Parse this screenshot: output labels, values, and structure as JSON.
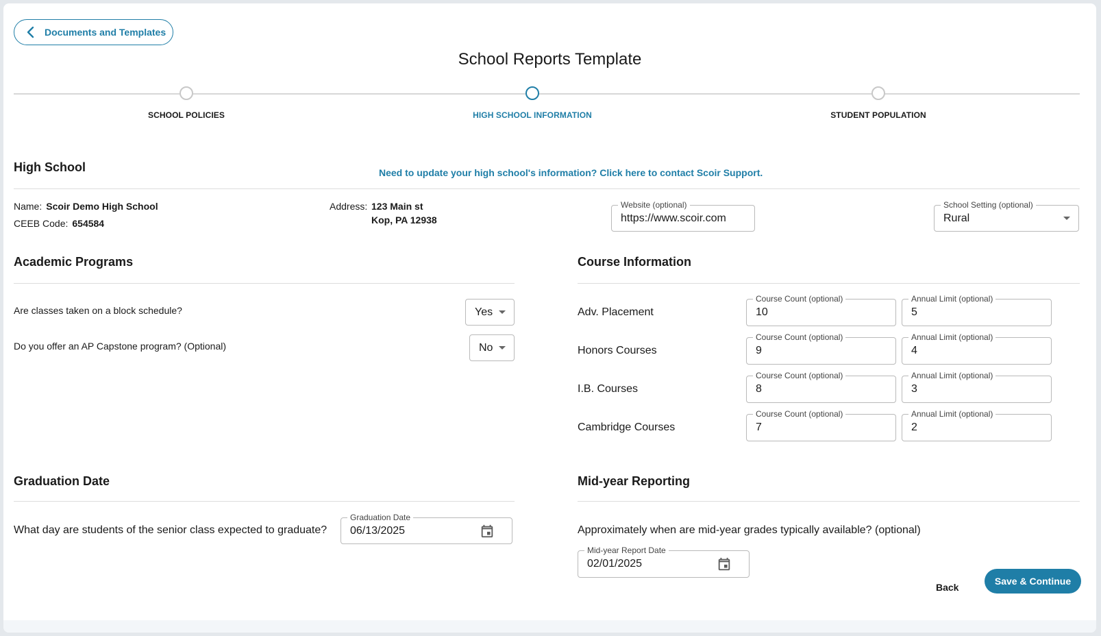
{
  "header": {
    "back_label": "Documents and Templates",
    "title": "School Reports Template"
  },
  "stepper": {
    "steps": [
      {
        "label": "SCHOOL POLICIES",
        "state": "inactive"
      },
      {
        "label": "HIGH SCHOOL INFORMATION",
        "state": "active"
      },
      {
        "label": "STUDENT POPULATION",
        "state": "inactive"
      }
    ]
  },
  "high_school": {
    "title": "High School",
    "support_link": "Need to update your high school's information? Click here to contact Scoir Support.",
    "name_label": "Name:",
    "name_value": "Scoir Demo High School",
    "ceeb_label": "CEEB Code:",
    "ceeb_value": "654584",
    "address_label": "Address:",
    "address_line1": "123 Main st",
    "address_line2": "Kop, PA 12938",
    "website_label": "Website (optional)",
    "website_value": "https://www.scoir.com",
    "setting_label": "School Setting (optional)",
    "setting_value": "Rural"
  },
  "academic_programs": {
    "title": "Academic Programs",
    "q1": "Are classes taken on a block schedule?",
    "q1_value": "Yes",
    "q2": "Do you offer an AP Capstone program? (Optional)",
    "q2_value": "No"
  },
  "course_information": {
    "title": "Course Information",
    "count_label": "Course Count (optional)",
    "limit_label": "Annual Limit (optional)",
    "rows": [
      {
        "label": "Adv. Placement",
        "count": "10",
        "limit": "5"
      },
      {
        "label": "Honors Courses",
        "count": "9",
        "limit": "4"
      },
      {
        "label": "I.B. Courses",
        "count": "8",
        "limit": "3"
      },
      {
        "label": "Cambridge Courses",
        "count": "7",
        "limit": "2"
      }
    ]
  },
  "graduation": {
    "title": "Graduation Date",
    "question": "What day are students of the senior class expected to graduate?",
    "field_label": "Graduation Date",
    "field_value": "06/13/2025"
  },
  "midyear": {
    "title": "Mid-year Reporting",
    "question": "Approximately when are mid-year grades typically available? (optional)",
    "field_label": "Mid-year Report Date",
    "field_value": "02/01/2025"
  },
  "actions": {
    "back": "Back",
    "save": "Save & Continue"
  },
  "colors": {
    "accent": "#1f7ea7",
    "border": "#b9b9b9",
    "divider": "#dcdcdc"
  }
}
